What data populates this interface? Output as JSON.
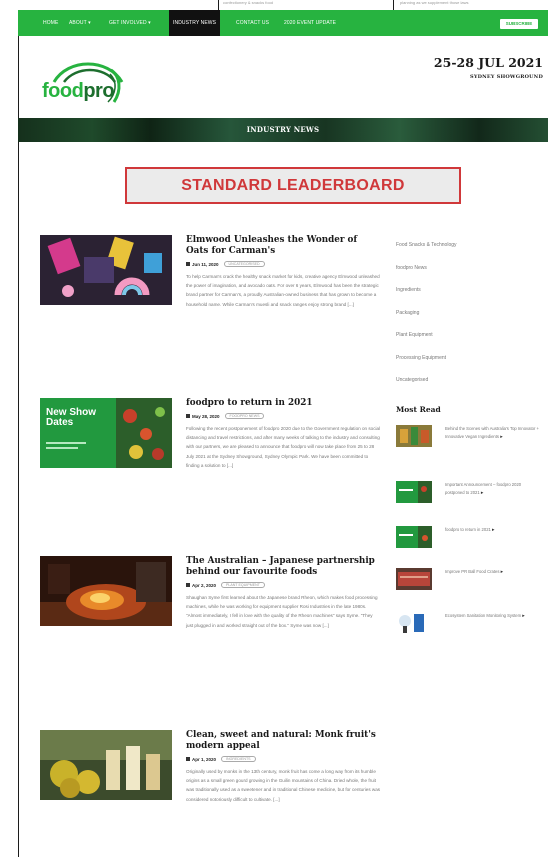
{
  "top_strip": {
    "left_text": "confectionery & snacks food",
    "right_text": "planning as we supplement those laws"
  },
  "nav": {
    "items": [
      "HOME",
      "ABOUT ▾",
      "GET INVOLVED ▾",
      "INDUSTRY NEWS",
      "CONTACT US",
      "2020 EVENT UPDATE"
    ],
    "active_index": 3,
    "subscribe_label": "SUBSCRIBE"
  },
  "brand": {
    "logo_food": "food",
    "logo_pro": "pro",
    "primary_color": "#27b340",
    "dark_green": "#1d6e2e"
  },
  "event": {
    "dates": "25-28 JUL 2021",
    "venue": "SYDNEY SHOWGROUND"
  },
  "banner": {
    "title": "INDUSTRY NEWS"
  },
  "leaderboard": {
    "label": "STANDARD LEADERBOARD",
    "color": "#d0383a"
  },
  "articles": [
    {
      "title": "Elmwood Unleashes the Wonder of Oats for Carman's",
      "date": "Jun 11, 2020",
      "tag": "UNCATEGORISED",
      "excerpt": "To help Carman's crack the healthy snack market for kids, creative agency Elmwood unleashed the power of imagination, and avocado oats. For over 6 years, Elmwood has been the strategic brand partner for Carman's, a proudly Australian-owned business that has grown to become a household name. While Carman's muesli and snack ranges enjoy strong brand [...]"
    },
    {
      "title": "foodpro to return in 2021",
      "date": "May 28, 2020",
      "tag": "FOODPRO NEWS",
      "thumb_text_1": "New Show",
      "thumb_text_2": "Dates",
      "excerpt": "Following the recent postponement of foodpro 2020 due to the Government regulation on social distancing and travel restrictions, and after many weeks of talking to the industry and consulting with our partners, we are pleased to announce that foodpro will now take place from 25 to 28 July 2021 at the Sydney Showground, Sydney Olympic Park. We have been committed to finding a solution to [...]"
    },
    {
      "title": "The Australian – Japanese partnership behind our favourite foods",
      "date": "Apr 2, 2020",
      "tag": "PLANT EQUIPMENT",
      "excerpt": "Shaughan Syme first learned about the Japanese brand Rheon, which makes food processing machines, while he was working for equipment supplier Rosi Industries in the late 1980s. \"Almost immediately, I fell in love with the quality of the Rheon machines\" says Syme. \"They just plugged in and worked straight out of the box.\" Syme was now [...]"
    },
    {
      "title": "Clean, sweet and natural: Monk fruit's modern appeal",
      "date": "Apr 1, 2020",
      "tag": "INGREDIENTS",
      "excerpt": "Originally used by monks in the 13th century, monk fruit has come a long way from its humble origins as a small green gourd growing in the Guilin mountains of China. Dried whole, the fruit was traditionally used as a sweetener and in traditional Chinese medicine, but for centuries was considered notoriously difficult to cultivate. [...]"
    }
  ],
  "categories": [
    "Food Snacks & Technology",
    "foodpro News",
    "Ingredients",
    "Packaging",
    "Plant Equipment",
    "Processing Equipment",
    "Uncategorised"
  ],
  "most_read": {
    "heading": "Most Read",
    "items": [
      "Behind the Scenes with Australia's Top Innovator + Innovative Vegan Ingredients",
      "Important Announcement – foodpro 2020 postponed to 2021",
      "foodpro to return in 2021",
      "Improve PR Ball Food Crates",
      "Ecosystem Sanitation Monitoring System"
    ],
    "arrow": "▸"
  }
}
